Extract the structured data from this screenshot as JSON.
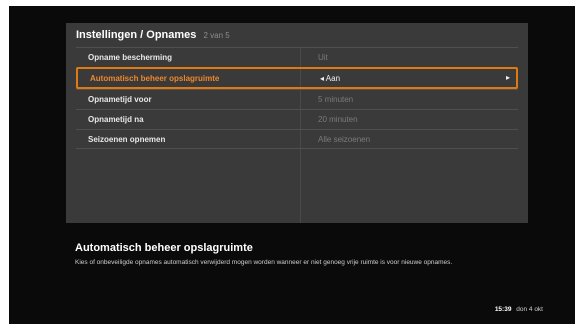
{
  "header": {
    "title": "Instellingen / Opnames",
    "page_indicator": "2 van 5"
  },
  "settings": [
    {
      "label": "Opname bescherming",
      "value": "Uit"
    },
    {
      "label": "Automatisch beheer opslagruimte",
      "value": "Aan"
    },
    {
      "label": "Opnametijd voor",
      "value": "5 minuten"
    },
    {
      "label": "Opnametijd na",
      "value": "20 minuten"
    },
    {
      "label": "Seizoenen opnemen",
      "value": "Alle seizoenen"
    }
  ],
  "selected_index": 1,
  "info": {
    "title": "Automatisch beheer opslagruimte",
    "description": "Kies of onbeveiligde opnames automatisch verwijderd mogen worden wanneer er niet genoeg vrije ruimte is voor nieuwe opnames."
  },
  "status": {
    "time": "15:39",
    "day": "don 4 okt"
  },
  "colors": {
    "accent": "#e07a10",
    "panel": "#3a3a3a",
    "background": "#0a0a0a"
  }
}
